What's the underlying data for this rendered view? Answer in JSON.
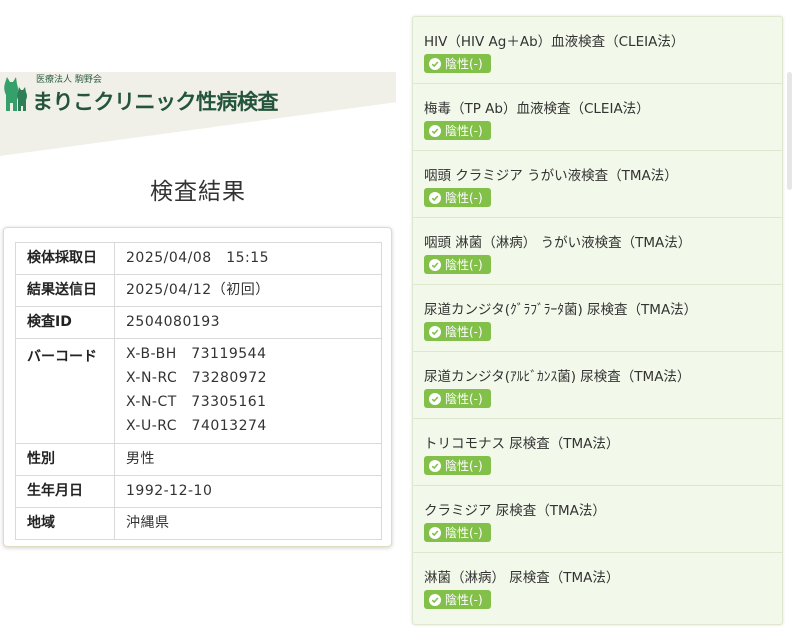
{
  "header": {
    "logo_small": "医療法人 駒野会",
    "logo_main": "まりこクリニック性病検査"
  },
  "page_title": "検査結果",
  "info": {
    "rows": [
      {
        "label": "検体採取日",
        "value": "2025/04/08　15:15"
      },
      {
        "label": "結果送信日",
        "value": "2025/04/12（初回）"
      },
      {
        "label": "検査ID",
        "value": "2504080193"
      },
      {
        "label": "バーコード",
        "values": [
          "X-B-BH　73119544",
          "X-N-RC　73280972",
          "X-N-CT　73305161",
          "X-U-RC　74013274"
        ]
      },
      {
        "label": "性別",
        "value": "男性"
      },
      {
        "label": "生年月日",
        "value": "1992-12-10"
      },
      {
        "label": "地域",
        "value": "沖縄県"
      }
    ]
  },
  "results": [
    {
      "name": "HIV（HIV Ag＋Ab）血液検査（CLEIA法）",
      "status": "陰性(-)"
    },
    {
      "name": "梅毒（TP Ab）血液検査（CLEIA法）",
      "status": "陰性(-)"
    },
    {
      "name": "咽頭 クラミジア うがい液検査（TMA法）",
      "status": "陰性(-)"
    },
    {
      "name": "咽頭 淋菌（淋病） うがい液検査（TMA法）",
      "status": "陰性(-)"
    },
    {
      "name": "尿道カンジタ(ｸﾞﾗﾌﾞﾗｰﾀ菌) 尿検査（TMA法）",
      "status": "陰性(-)"
    },
    {
      "name": "尿道カンジタ(ｱﾙﾋﾞｶﾝｽ菌) 尿検査（TMA法）",
      "status": "陰性(-)"
    },
    {
      "name": "トリコモナス 尿検査（TMA法）",
      "status": "陰性(-)"
    },
    {
      "name": "クラミジア 尿検査（TMA法）",
      "status": "陰性(-)"
    },
    {
      "name": "淋菌（淋病） 尿検査（TMA法）",
      "status": "陰性(-)"
    }
  ],
  "colors": {
    "brand": "#24553a",
    "badge": "#82c04a",
    "panel": "#f2f8ea"
  }
}
